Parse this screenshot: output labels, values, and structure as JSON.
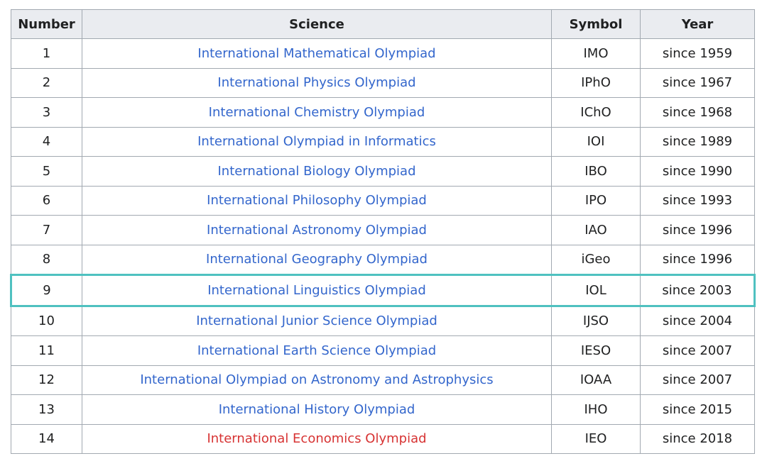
{
  "headers": {
    "number": "Number",
    "science": "Science",
    "symbol": "Symbol",
    "year": "Year"
  },
  "colors": {
    "link": "#3366cc",
    "redlink": "#d73333",
    "highlight": "#4fc1c0"
  },
  "rows": [
    {
      "number": "1",
      "science": "International Mathematical Olympiad",
      "symbol": "IMO",
      "year": "since 1959"
    },
    {
      "number": "2",
      "science": "International Physics Olympiad",
      "symbol": "IPhO",
      "year": "since 1967"
    },
    {
      "number": "3",
      "science": "International Chemistry Olympiad",
      "symbol": "IChO",
      "year": "since 1968"
    },
    {
      "number": "4",
      "science": "International Olympiad in Informatics",
      "symbol": "IOI",
      "year": "since 1989"
    },
    {
      "number": "5",
      "science": "International Biology Olympiad",
      "symbol": "IBO",
      "year": "since 1990"
    },
    {
      "number": "6",
      "science": "International Philosophy Olympiad",
      "symbol": "IPO",
      "year": "since 1993"
    },
    {
      "number": "7",
      "science": "International Astronomy Olympiad",
      "symbol": "IAO",
      "year": "since 1996"
    },
    {
      "number": "8",
      "science": "International Geography Olympiad",
      "symbol": "iGeo",
      "year": "since 1996"
    },
    {
      "number": "9",
      "science": "International Linguistics Olympiad",
      "symbol": "IOL",
      "year": "since 2003"
    },
    {
      "number": "10",
      "science": "International Junior Science Olympiad",
      "symbol": "IJSO",
      "year": "since 2004"
    },
    {
      "number": "11",
      "science": "International Earth Science Olympiad",
      "symbol": "IESO",
      "year": "since 2007"
    },
    {
      "number": "12",
      "science": "International Olympiad on Astronomy and Astrophysics",
      "symbol": "IOAA",
      "year": "since 2007"
    },
    {
      "number": "13",
      "science": "International History Olympiad",
      "symbol": "IHO",
      "year": "since 2015"
    },
    {
      "number": "14",
      "science": "International Economics Olympiad",
      "symbol": "IEO",
      "year": "since 2018"
    }
  ]
}
